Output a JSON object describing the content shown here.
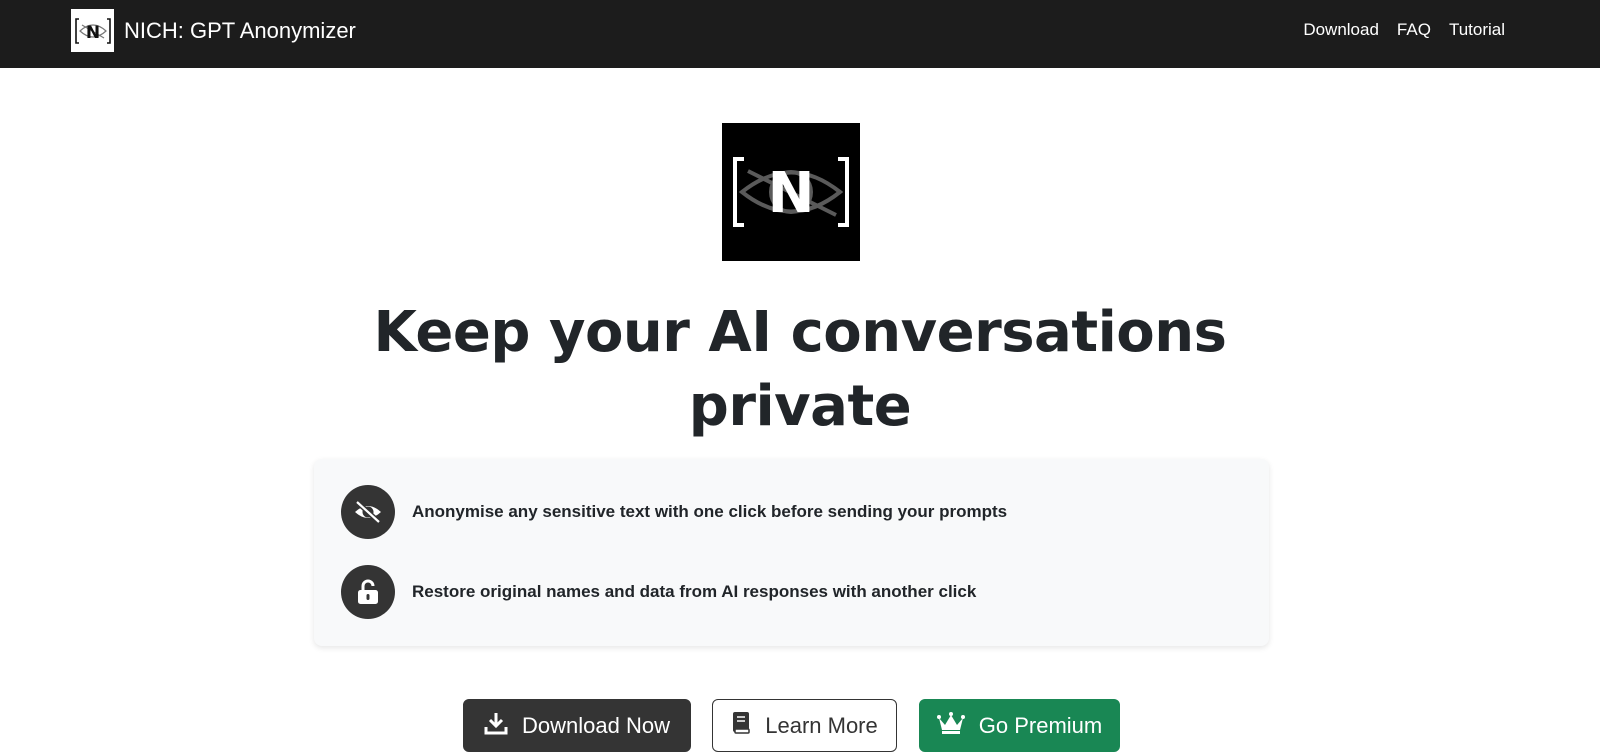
{
  "navbar": {
    "brand_name": "NICH: GPT Anonymizer",
    "links": [
      "Download",
      "FAQ",
      "Tutorial"
    ]
  },
  "hero": {
    "headline_line1": "Keep your AI conversations",
    "headline_line2": "private"
  },
  "features": [
    {
      "icon": "eye-slash-icon",
      "text": "Anonymise any sensitive text with one click before sending your prompts"
    },
    {
      "icon": "lock-open-icon",
      "text": "Restore original names and data from AI responses with another click"
    }
  ],
  "buttons": {
    "download": {
      "label": "Download Now",
      "icon": "download-icon"
    },
    "learn": {
      "label": "Learn More",
      "icon": "book-icon"
    },
    "premium": {
      "label": "Go Premium",
      "icon": "crown-icon"
    }
  },
  "colors": {
    "navbar_bg": "#1c1c1c",
    "dark": "#343434",
    "premium_green": "#198754",
    "card_bg": "#f8f9fa"
  }
}
